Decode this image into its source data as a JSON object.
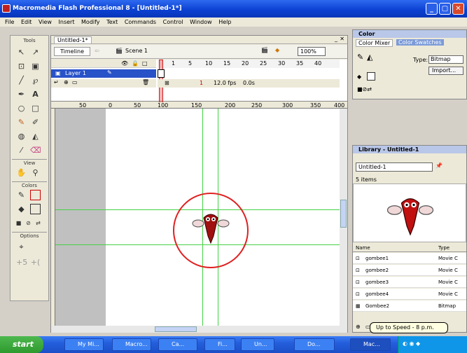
{
  "window": {
    "title": "Macromedia Flash Professional 8 - [Untitled-1*]",
    "minimize": "_",
    "maximize": "▢",
    "close": "✕"
  },
  "menu": [
    "File",
    "Edit",
    "View",
    "Insert",
    "Modify",
    "Text",
    "Commands",
    "Control",
    "Window",
    "Help"
  ],
  "tools": {
    "header": "Tools",
    "view_label": "View",
    "colors_label": "Colors",
    "options_label": "Options"
  },
  "document": {
    "tab": "Untitled-1*",
    "timeline_tab": "Timeline",
    "scene": "Scene 1",
    "zoom": "100%",
    "layer_name": "Layer 1",
    "frame_numbers": [
      "1",
      "5",
      "10",
      "15",
      "20",
      "25",
      "30",
      "35",
      "40",
      "45"
    ],
    "status": [
      "1",
      "12.0 fps",
      "0.0s"
    ],
    "ruler_ticks": [
      "50",
      "0",
      "50",
      "100",
      "150",
      "200",
      "250",
      "300",
      "350",
      "400"
    ]
  },
  "color_panel": {
    "title": "Color",
    "tab_mixer": "Color Mixer",
    "tab_swatches": "Color Swatches",
    "type_label": "Type:",
    "type_value": "Bitmap",
    "import_button": "Import..."
  },
  "library_panel": {
    "title": "Library - Untitled-1",
    "doc_select": "Untitled-1",
    "count": "5 items",
    "col_name": "Name",
    "col_type": "Type",
    "items": [
      {
        "name": "gombee1",
        "type": "Movie C"
      },
      {
        "name": "gombee2",
        "type": "Movie C"
      },
      {
        "name": "gombee3",
        "type": "Movie C"
      },
      {
        "name": "gombee4",
        "type": "Movie C"
      },
      {
        "name": "Gombee2",
        "type": "Bitmap"
      }
    ]
  },
  "taskbar": {
    "start": "start",
    "tasks": [
      "My Mi...",
      "Macro...",
      "Ca...",
      "Fi...",
      "Un...",
      "Do...",
      "Mac..."
    ],
    "tooltip": "Up to Speed - 8 p.m."
  },
  "colors": {
    "guide": "#45d045",
    "circle": "#e02020",
    "bug": "#a01010"
  }
}
